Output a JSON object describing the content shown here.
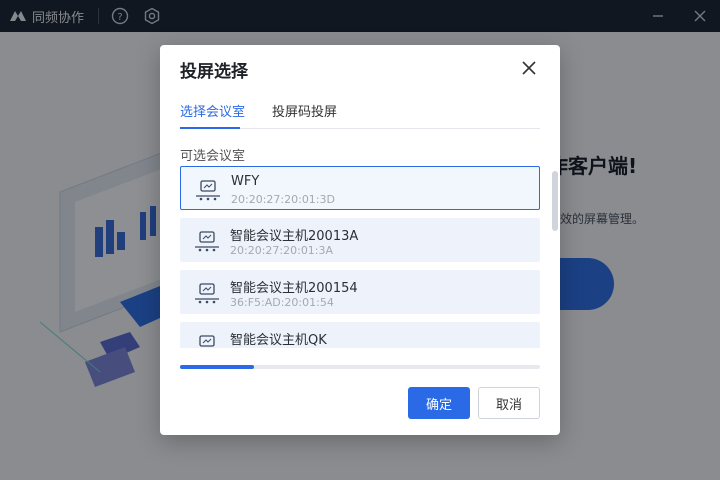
{
  "titlebar": {
    "app_title": "同频协作",
    "icons": [
      "app-logo-icon",
      "help-icon",
      "settings-icon",
      "minimize-icon",
      "close-icon"
    ]
  },
  "background": {
    "hero_title": "作客户端!",
    "hero_subtitle": "效的屏幕管理。"
  },
  "modal": {
    "title": "投屏选择",
    "tabs": [
      {
        "label": "选择会议室",
        "active": true
      },
      {
        "label": "投屏码投屏",
        "active": false
      }
    ],
    "section_label": "可选会议室",
    "rooms": [
      {
        "name": "WFY",
        "mac": "20:20:27:20:01:3D",
        "selected": true
      },
      {
        "name": "智能会议主机20013A",
        "mac": "20:20:27:20:01:3A",
        "selected": false
      },
      {
        "name": "智能会议主机200154",
        "mac": "36:F5:AD:20:01:54",
        "selected": false
      },
      {
        "name": "智能会议主机QK",
        "mac": "",
        "selected": false
      }
    ],
    "confirm_label": "确定",
    "cancel_label": "取消"
  },
  "colors": {
    "accent": "#2a6ae6",
    "titlebar_bg": "#1d2937",
    "room_bg": "#eef3fb"
  }
}
